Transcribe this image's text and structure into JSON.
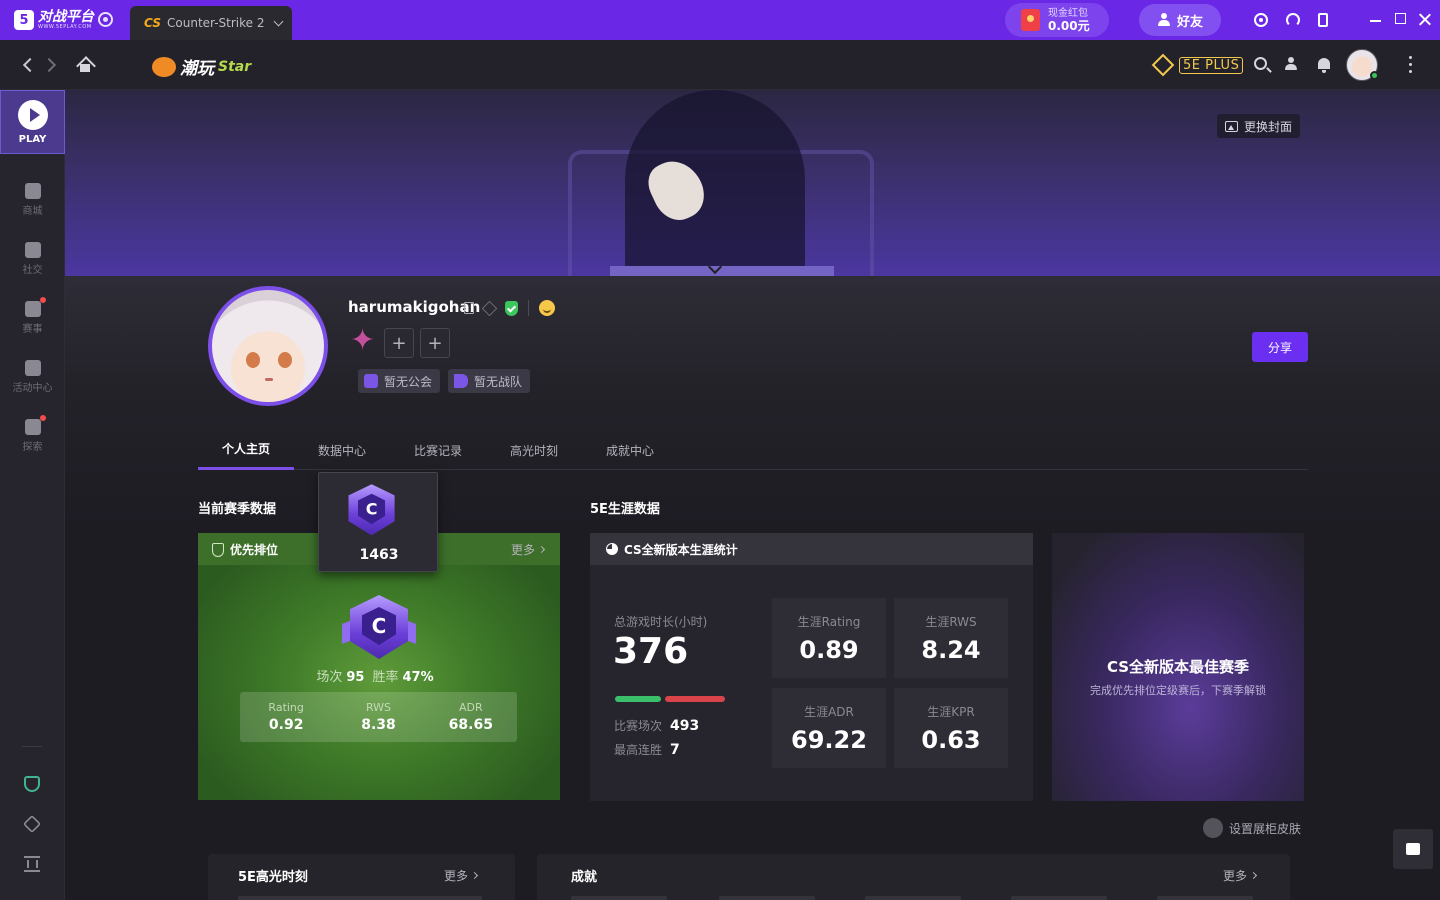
{
  "titlebar": {
    "logo_text": "对战平台",
    "logo_sub": "WWW.5EPLAY.COM",
    "game_tab": "Counter-Strike 2",
    "cs_glyph": "CS",
    "redpack_label": "现金红包",
    "redpack_value": "0.00元",
    "friends_label": "好友"
  },
  "navbar": {
    "brand_text": "潮玩",
    "brand_star": "Star",
    "plus_label": "5E PLUS"
  },
  "sidebar": {
    "play_label": "PLAY",
    "items": [
      {
        "label": "商城"
      },
      {
        "label": "社交"
      },
      {
        "label": "赛事"
      },
      {
        "label": "活动中心"
      },
      {
        "label": "探索"
      }
    ]
  },
  "banner": {
    "change_cover": "更换封面"
  },
  "profile": {
    "username": "harumakigohan",
    "guild_tag": "暂无公会",
    "team_tag": "暂无战队",
    "share_label": "分享",
    "add_symbol": "+"
  },
  "tabs": [
    "个人主页",
    "数据中心",
    "比赛记录",
    "高光时刻",
    "成就中心"
  ],
  "season": {
    "heading": "当前赛季数据",
    "mode_label": "优先排位",
    "more": "更多",
    "popup_score": "1463",
    "rank_letter": "C",
    "matches_label": "场次",
    "matches_value": "95",
    "winrate_label": "胜率",
    "winrate_value": "47%",
    "metrics": [
      {
        "label": "Rating",
        "value": "0.92"
      },
      {
        "label": "RWS",
        "value": "8.38"
      },
      {
        "label": "ADR",
        "value": "68.65"
      }
    ]
  },
  "career": {
    "heading": "5E生涯数据",
    "panel_title": "CS全新版本生涯统计",
    "total_label": "总游戏时长(小时)",
    "total_value": "376",
    "matches_label": "比赛场次",
    "matches_value": "493",
    "streak_label": "最高连胜",
    "streak_value": "7",
    "tiles": [
      {
        "label": "生涯Rating",
        "value": "0.89"
      },
      {
        "label": "生涯RWS",
        "value": "8.24"
      },
      {
        "label": "生涯ADR",
        "value": "69.22"
      },
      {
        "label": "生涯KPR",
        "value": "0.63"
      }
    ]
  },
  "best_season": {
    "title": "CS全新版本最佳赛季",
    "subtitle": "完成优先排位定级赛后，下赛季解锁"
  },
  "skin_label": "设置展柜皮肤",
  "bottom": {
    "highlights_title": "5E高光时刻",
    "highlights_more": "更多",
    "achievements_title": "成就",
    "achievements_more": "更多"
  },
  "colors": {
    "accent": "#6a27e6",
    "season_green": "#3e7a28",
    "win": "#3cbf6a",
    "loss": "#d9444a"
  }
}
